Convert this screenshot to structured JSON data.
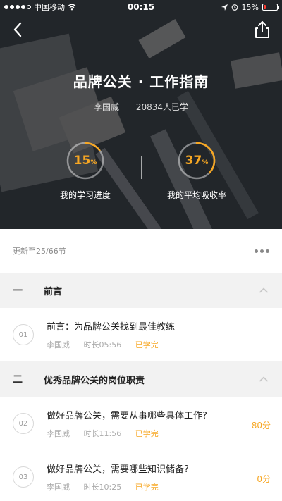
{
  "status_bar": {
    "carrier": "中国移动",
    "time": "00:15",
    "battery": "15%",
    "signal_icon": "signal-dots-icon",
    "wifi_icon": "wifi-icon",
    "location_icon": "location-arrow-icon",
    "alarm_icon": "alarm-icon"
  },
  "nav": {
    "back_icon": "chevron-left-icon",
    "share_icon": "share-icon"
  },
  "course": {
    "title": "品牌公关 · 工作指南",
    "author": "李国威",
    "learners": "20834人已学"
  },
  "stats": {
    "progress": {
      "value": "15",
      "unit": "%",
      "fraction": 0.15,
      "label": "我的学习进度"
    },
    "absorption": {
      "value": "37",
      "unit": "%",
      "fraction": 0.37,
      "label": "我的平均吸收率"
    }
  },
  "update": {
    "text": "更新至25/66节",
    "more_icon": "more-horizontal-icon"
  },
  "sections": [
    {
      "number": "一",
      "title": "前言",
      "lessons": [
        {
          "number": "01",
          "title": "前言：为品牌公关找到最佳教练",
          "author": "李国威",
          "duration": "时长05:56",
          "status": "已学完",
          "score": ""
        }
      ]
    },
    {
      "number": "二",
      "title": "优秀品牌公关的岗位职责",
      "lessons": [
        {
          "number": "02",
          "title": "做好品牌公关，需要从事哪些具体工作?",
          "author": "李国威",
          "duration": "时长11:56",
          "status": "已学完",
          "score": "80分"
        },
        {
          "number": "03",
          "title": "做好品牌公关，需要哪些知识储备?",
          "author": "李国威",
          "duration": "时长10:25",
          "status": "已学完",
          "score": "0分"
        }
      ]
    }
  ],
  "colors": {
    "accent": "#f7a723",
    "text": "#222222",
    "muted": "#aaaaaa",
    "section_bg": "#f2f2f2"
  }
}
